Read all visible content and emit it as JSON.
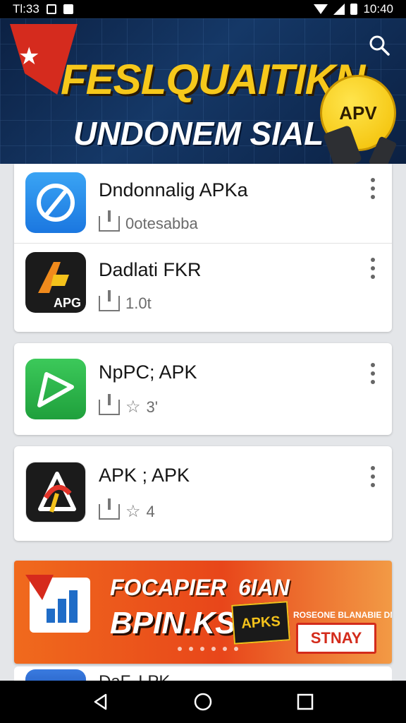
{
  "status_bar": {
    "time": "Tl:33",
    "clock": "10:40"
  },
  "hero": {
    "title_line1": "FESLQUAITIKN",
    "title_line2": "UNDONEM SIAL",
    "badge": "APV"
  },
  "apps": [
    {
      "name": "Dndonnalig APKa",
      "meta": "0otesabba",
      "icon": "app-blue",
      "icon_text": "",
      "rating": ""
    },
    {
      "name": "Dadlati FKR",
      "meta": "1.0t",
      "icon": "app-dark",
      "icon_text": "APG",
      "rating": ""
    },
    {
      "name": "NpPC; APK",
      "meta": "",
      "icon": "app-green",
      "icon_text": "",
      "rating": "3'"
    },
    {
      "name": "APK ; APK",
      "meta": "",
      "icon": "app-white",
      "icon_text": "",
      "rating": "4"
    }
  ],
  "banner": {
    "line1": "FOCAPIER",
    "line2": "BPIN.KS",
    "line3": "6IAN",
    "box_text": "APKS",
    "subtext": "ROSEONE BLANABIE DN",
    "cta": "STNAY"
  },
  "peek_item": {
    "name": "DaF. I PK"
  },
  "colors": {
    "accent": "#f6c81b",
    "banner": "#e8461a",
    "hero_bg": "#153867"
  }
}
